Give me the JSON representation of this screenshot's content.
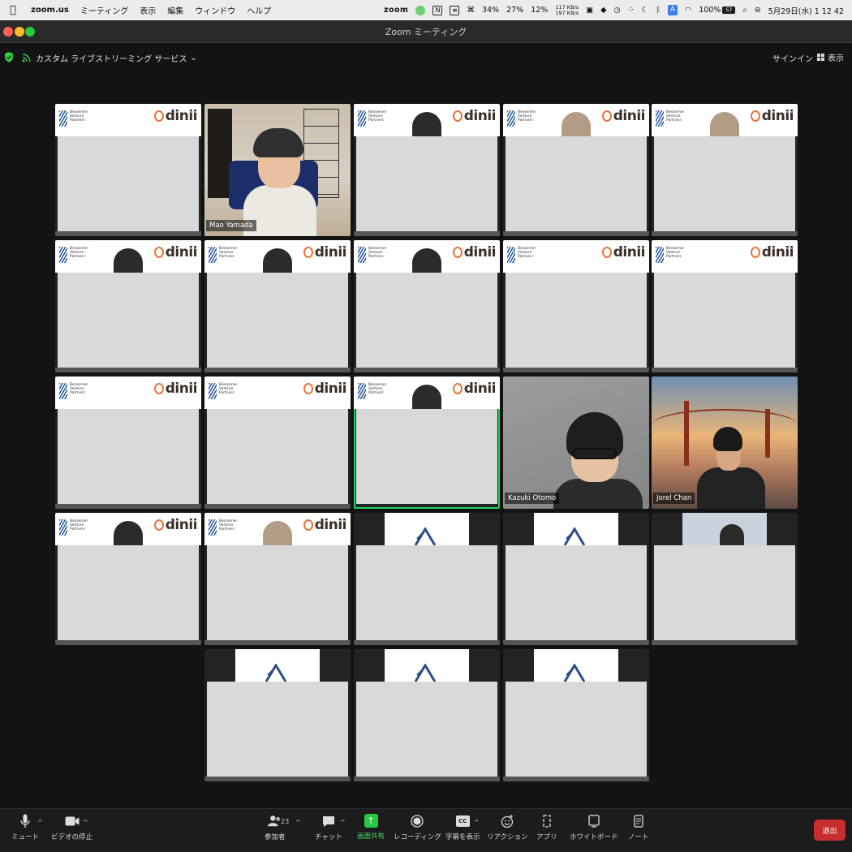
{
  "menubar": {
    "app_name": "zoom.us",
    "items": [
      "ミーティング",
      "表示",
      "編集",
      "ウィンドウ",
      "ヘルプ"
    ],
    "status": {
      "zoom_label": "zoom",
      "cpu": "34%",
      "mem": "27%",
      "disk": "12%",
      "net_up": "117 KB/s",
      "net_down": "197 KB/s",
      "battery": "100%",
      "battery_icon_text": "57",
      "datetime": "5月29日(水)  1 12 42"
    }
  },
  "window": {
    "title": "Zoom ミーティング"
  },
  "subbar": {
    "stream_menu_label": "カスタム ライブストリーミング サービス",
    "signin_label": "サインイン",
    "view_label": "表示"
  },
  "tiles": {
    "mao_name": "Mao Yamada",
    "kazuki_name": "Kazuki Otomo",
    "jorel_name": "Jorel Chan",
    "bvp_line1": "Bessemer",
    "bvp_line2": "Venture",
    "bvp_line3": "Partners",
    "dinii_label": "dinii"
  },
  "toolbar": {
    "mute_label": "ミュート",
    "video_label": "ビデオの停止",
    "participants_label": "参加者",
    "participants_count": "23",
    "chat_label": "チャット",
    "share_label": "画面共有",
    "record_label": "レコーディング",
    "cc_label": "字幕を表示",
    "reaction_label": "リアクション",
    "apps_label": "アプリ",
    "whiteboard_label": "ホワイトボード",
    "notes_label": "ノート",
    "leave_label": "退出",
    "cc_icon_text": "CC"
  },
  "colors": {
    "active_speaker_border": "#23d160",
    "share_button": "#28c840",
    "leave_button": "#c72e2e",
    "dinii_ring": "#e8743b"
  }
}
